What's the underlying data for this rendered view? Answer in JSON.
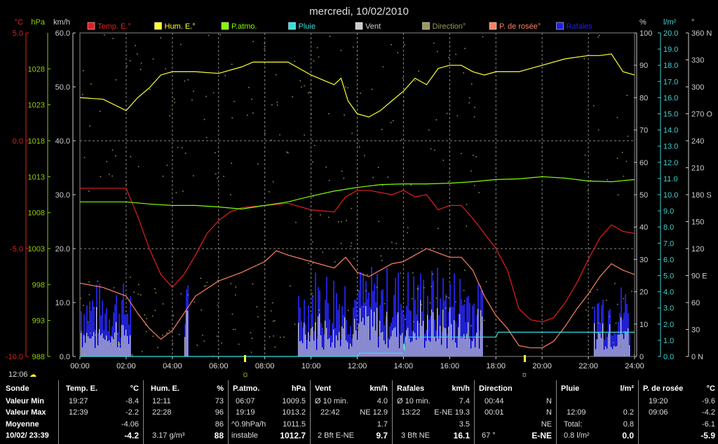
{
  "title": "mercredi, 10/02/2010",
  "chart_data": {
    "type": "line",
    "x_ticks": [
      "00:00",
      "02:00",
      "04:00",
      "06:00",
      "08:00",
      "10:00",
      "12:00",
      "14:00",
      "16:00",
      "18:00",
      "20:00",
      "22:00",
      "24:00"
    ],
    "left_axes": {
      "temp": {
        "unit": "°C",
        "color": "#e02020",
        "ticks": [
          "5.0",
          "0.0",
          "-5.0",
          "-10.0"
        ],
        "range": [
          -10,
          5
        ]
      },
      "pressure": {
        "unit": "hPa",
        "color": "#8fd000",
        "ticks": [
          "1028",
          "1023",
          "1018",
          "1013",
          "1008",
          "1003",
          "998",
          "993",
          "988"
        ],
        "range": [
          988,
          1033
        ]
      },
      "wind": {
        "unit": "km/h",
        "color": "#cccccc",
        "ticks": [
          "60.0",
          "50.0",
          "40.0",
          "30.0",
          "20.0",
          "10.0",
          "0.0"
        ],
        "range": [
          0,
          60
        ]
      }
    },
    "right_axes": {
      "humidity": {
        "unit": "%",
        "color": "#cccccc",
        "ticks": [
          "100",
          "90",
          "80",
          "70",
          "60",
          "50",
          "40",
          "30",
          "20",
          "10",
          "0"
        ],
        "range": [
          0,
          100
        ]
      },
      "rain": {
        "unit": "l/m²",
        "color": "#3fd0d0",
        "ticks": [
          "20.0",
          "19.0",
          "18.0",
          "17.0",
          "16.0",
          "15.0",
          "14.0",
          "13.0",
          "12.0",
          "11.0",
          "10.0",
          "9.0",
          "8.0",
          "7.0",
          "6.0",
          "5.0",
          "4.0",
          "3.0",
          "2.0",
          "1.0",
          "0.0"
        ],
        "range": [
          0,
          20
        ]
      },
      "direction": {
        "unit": "°",
        "color": "#cccccc",
        "ticks": [
          "360 N",
          "330",
          "300",
          "270 O",
          "240",
          "210",
          "180 S",
          "150",
          "120",
          "90 E",
          "60",
          "30",
          "0 N"
        ],
        "range": [
          0,
          360
        ]
      }
    },
    "legend": [
      {
        "label": "Temp. E.°",
        "color": "#e02020"
      },
      {
        "label": "Hum. E.°",
        "color": "#ffff33"
      },
      {
        "label": "P.atmo.",
        "color": "#7fff00"
      },
      {
        "label": "Pluie",
        "color": "#33e0e0"
      },
      {
        "label": "Vent",
        "color": "#cccccc"
      },
      {
        "label": "Direction°",
        "color": "#9a9a5a"
      },
      {
        "label": "P. de rosée°",
        "color": "#ff8060"
      },
      {
        "label": "Rafales",
        "color": "#2020e0"
      }
    ],
    "series": [
      {
        "name": "Temp. E.°",
        "axis": "temp",
        "color": "#e02020",
        "x": [
          0,
          2,
          2.5,
          3,
          3.5,
          4,
          4.5,
          5,
          5.5,
          6,
          6.5,
          7,
          8,
          9,
          10,
          11,
          11.5,
          12,
          12.5,
          13,
          13.5,
          14,
          14.5,
          15,
          15.5,
          16,
          16.5,
          17,
          17.5,
          18,
          18.5,
          19,
          19.5,
          20,
          20.5,
          21,
          21.5,
          22,
          22.5,
          23,
          23.5,
          24
        ],
        "y": [
          -2.2,
          -2.2,
          -3.5,
          -5,
          -6.2,
          -6.8,
          -6.2,
          -5.3,
          -4.3,
          -3.7,
          -3.3,
          -3.1,
          -3,
          -2.9,
          -3.2,
          -3.3,
          -2.6,
          -2.3,
          -2.3,
          -2.4,
          -2.5,
          -2.3,
          -2.6,
          -2.5,
          -3.2,
          -3,
          -3,
          -3.6,
          -4.3,
          -5,
          -6,
          -7.8,
          -8.3,
          -8.4,
          -8.2,
          -7.5,
          -6.6,
          -5.5,
          -4.5,
          -3.9,
          -4.2,
          -4.3
        ]
      },
      {
        "name": "P. de rosée°",
        "axis": "temp",
        "color": "#ff8060",
        "x": [
          0,
          1,
          2,
          2.5,
          3,
          3.5,
          4,
          4.5,
          5,
          6,
          7,
          8,
          8.5,
          9,
          10,
          11,
          11.5,
          12,
          12.5,
          13,
          13.5,
          14,
          14.5,
          15,
          15.5,
          16,
          16.5,
          17,
          17.5,
          18,
          18.5,
          19,
          19.5,
          20,
          20.5,
          21,
          21.5,
          22,
          22.5,
          23,
          23.5,
          24
        ],
        "y": [
          -6.6,
          -6.8,
          -7.2,
          -8,
          -8.7,
          -9.2,
          -8.8,
          -8,
          -7.2,
          -6.5,
          -6.1,
          -5.6,
          -5.1,
          -5.3,
          -5.6,
          -5.9,
          -5.4,
          -6.1,
          -6.3,
          -6,
          -5.7,
          -5.6,
          -5.3,
          -5,
          -5.2,
          -5.4,
          -5.4,
          -6,
          -7.2,
          -8.1,
          -8.7,
          -9.5,
          -9.6,
          -9.6,
          -9.3,
          -8.6,
          -7.8,
          -7.1,
          -6.3,
          -5.7,
          -6,
          -6.2
        ]
      },
      {
        "name": "Hum. E.°",
        "axis": "humidity",
        "color": "#ffff33",
        "x": [
          0,
          1,
          2,
          2.5,
          3,
          3.5,
          4,
          4.5,
          5,
          6,
          7,
          7.5,
          8,
          9,
          10,
          11,
          11.3,
          11.6,
          12,
          12.5,
          13,
          13.5,
          14,
          14.5,
          15,
          15.5,
          16,
          16.5,
          17,
          17.5,
          18,
          18.5,
          19,
          20,
          21,
          22,
          22.5,
          23,
          23.5,
          24
        ],
        "y": [
          80,
          79.5,
          76,
          80,
          83,
          87,
          88,
          88,
          88,
          87.5,
          89.5,
          91,
          91,
          91,
          87,
          84,
          86,
          79,
          75,
          74,
          76,
          79,
          82,
          86,
          84,
          89,
          90,
          90,
          88,
          87,
          88,
          88,
          88,
          90,
          92,
          93,
          93,
          93.5,
          88,
          87
        ]
      },
      {
        "name": "P.atmo.",
        "axis": "pressure",
        "color": "#7fff00",
        "x": [
          0,
          2,
          3,
          4,
          5,
          6,
          7,
          8,
          9,
          10,
          11,
          12,
          13,
          14,
          15,
          16,
          17,
          18,
          19,
          20,
          21,
          22,
          23,
          24
        ],
        "y": [
          1009.5,
          1009.5,
          1009.2,
          1009.0,
          1009.0,
          1008.8,
          1008.5,
          1009.0,
          1009.5,
          1010.3,
          1011.0,
          1011.5,
          1011.9,
          1012.0,
          1012.0,
          1012.1,
          1012.3,
          1012.6,
          1012.7,
          1013.0,
          1012.8,
          1012.4,
          1012.3,
          1012.6
        ]
      },
      {
        "name": "Pluie",
        "axis": "rain",
        "color": "#33e0e0",
        "x": [
          0,
          12,
          12.1,
          14,
          14.1,
          18,
          18.1,
          22.5,
          22.6,
          24
        ],
        "y": [
          0,
          0,
          0.2,
          0.2,
          1.2,
          1.2,
          1.5,
          1.5,
          1.5,
          1.5
        ]
      }
    ]
  },
  "time_readout": "12:06",
  "stats": {
    "sonde": {
      "header": "Sonde",
      "min": "Valeur Min",
      "max": "Valeur Max",
      "avg": "Moyenne",
      "now": "10/02/ 23:39"
    },
    "temp": {
      "header": "Temp. E.",
      "unit": "°C",
      "min_time": "19:27",
      "min": "-8.4",
      "max_time": "12:39",
      "max": "-2.2",
      "avg": "-4.06",
      "now": "-4.2"
    },
    "hum": {
      "header": "Hum. E.",
      "unit": "%",
      "min_time": "12:11",
      "min": "73",
      "max_time": "22:28",
      "max": "96",
      "avg": "86",
      "abs": "3.17 g/m³",
      "now": "88"
    },
    "patmo": {
      "header": "P.atmo.",
      "unit": "hPa",
      "min_time": "06:07",
      "min": "1009.5",
      "max_time": "19:19",
      "max": "1013.2",
      "trend": "^0.9hPa/h",
      "avg": "1011.5",
      "state": "instable",
      "now": "1012.7"
    },
    "vent": {
      "header": "Vent",
      "unit": "km/h",
      "r1_label": "Ø 10 min.",
      "r1_val": "4.0",
      "r2_label": "22:42",
      "r2_dir": "NE 12.9",
      "avg": "1.7",
      "bft": "2 Bft E-NE",
      "now": "9.7"
    },
    "rafales": {
      "header": "Rafales",
      "unit": "km/h",
      "r1_label": "Ø 10 min.",
      "r1_val": "7.4",
      "r2_label": "13:22",
      "r2_dir": "E-NE 19.3",
      "avg": "3.5",
      "bft": "3 Bft NE",
      "now": "16.1"
    },
    "direction": {
      "header": "Direction",
      "r1_time": "00:44",
      "r1_val": "N",
      "r2_time": "00:01",
      "r2_val": "N",
      "avg": "NE",
      "deg": "67 °",
      "now": "E-NE"
    },
    "pluie": {
      "header": "Pluie",
      "unit": "l/m²",
      "r2_time": "12:09",
      "r2_val": "0.2",
      "total_label": "Total:",
      "total": "0.8",
      "rate": "0.8 l/m²",
      "now": "0.0"
    },
    "rosee": {
      "header": "P. de rosée",
      "unit": "°C",
      "min_time": "19:20",
      "min": "-9.6",
      "max_time": "09:06",
      "max": "-4.2",
      "avg": "-6.1",
      "now": "-5.9"
    }
  }
}
